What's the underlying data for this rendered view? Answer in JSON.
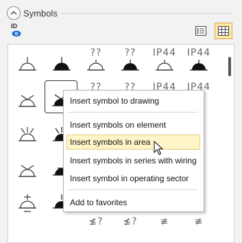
{
  "panel": {
    "title": "Symbols"
  },
  "toolbar": {
    "id_label": "ID"
  },
  "gallery": {
    "text_symbols": {
      "a": "??",
      "b": "IP44",
      "c": "≰?"
    }
  },
  "context_menu": {
    "items": [
      "Insert symbol to drawing",
      "Insert symbols on element",
      "Insert symbols in area",
      "Insert symbols in series with wiring",
      "Insert symbol in operating sector",
      "Add to favorites"
    ],
    "highlighted_index": 2
  }
}
